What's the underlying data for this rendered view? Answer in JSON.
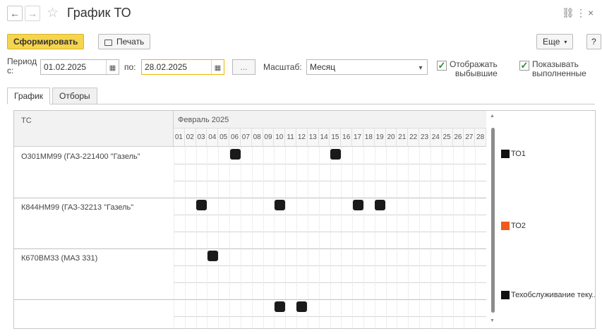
{
  "window": {
    "title": "График ТО",
    "back_icon": "←",
    "forward_icon": "→",
    "star_icon": "☆",
    "link_icon": "⛓",
    "more_icon": "⋮",
    "close_icon": "×"
  },
  "toolbar": {
    "generate_label": "Сформировать",
    "print_label": "Печать",
    "more_label": "Еще",
    "help_label": "?"
  },
  "filters": {
    "period_label_1": "Период",
    "period_label_2": "с:",
    "date_from": "01.02.2025",
    "to_label": "по:",
    "date_to": "28.02.2025",
    "ellipsis_label": "...",
    "scale_label": "Масштаб:",
    "scale_value": "Месяц",
    "show_retired_label_1": "Отображать",
    "show_retired_label_2": "выбывшие",
    "show_retired_checked": true,
    "show_done_label_1": "Показывать",
    "show_done_label_2": "выполненные",
    "show_done_checked": true
  },
  "tabs": [
    {
      "label": "График",
      "active": true
    },
    {
      "label": "Отборы",
      "active": false
    }
  ],
  "gantt": {
    "col_header": "ТС",
    "month_label": "Февраль 2025",
    "days": [
      "01",
      "02",
      "03",
      "04",
      "05",
      "06",
      "07",
      "08",
      "09",
      "10",
      "11",
      "12",
      "13",
      "14",
      "15",
      "16",
      "17",
      "18",
      "19",
      "20",
      "21",
      "22",
      "23",
      "24",
      "25",
      "26",
      "27",
      "28"
    ],
    "rows": [
      {
        "name": "О301ММ99 (ГАЗ-221400 \"Газель\"",
        "events": [
          {
            "day": 6,
            "type": "ТО1"
          },
          {
            "day": 15,
            "type": "ТО1"
          }
        ]
      },
      {
        "name": "К844НМ99 (ГАЗ-32213 \"Газель\"",
        "events": [
          {
            "day": 3,
            "type": "ТО1"
          },
          {
            "day": 10,
            "type": "ТО1"
          },
          {
            "day": 17,
            "type": "ТО1"
          },
          {
            "day": 19,
            "type": "ТО1"
          }
        ]
      },
      {
        "name": "К670ВМ33 (МАЗ 331)",
        "events": [
          {
            "day": 4,
            "type": "ТО1"
          }
        ]
      },
      {
        "name": "",
        "events": [
          {
            "day": 10,
            "type": "ТО1"
          },
          {
            "day": 12,
            "type": "ТО1"
          }
        ]
      }
    ],
    "legend": [
      {
        "label": "ТО1",
        "color": "#111111"
      },
      {
        "label": "ТО2",
        "color": "#f05a1e"
      },
      {
        "label": "Техобслуживание теку...",
        "color": "#111111"
      }
    ]
  }
}
